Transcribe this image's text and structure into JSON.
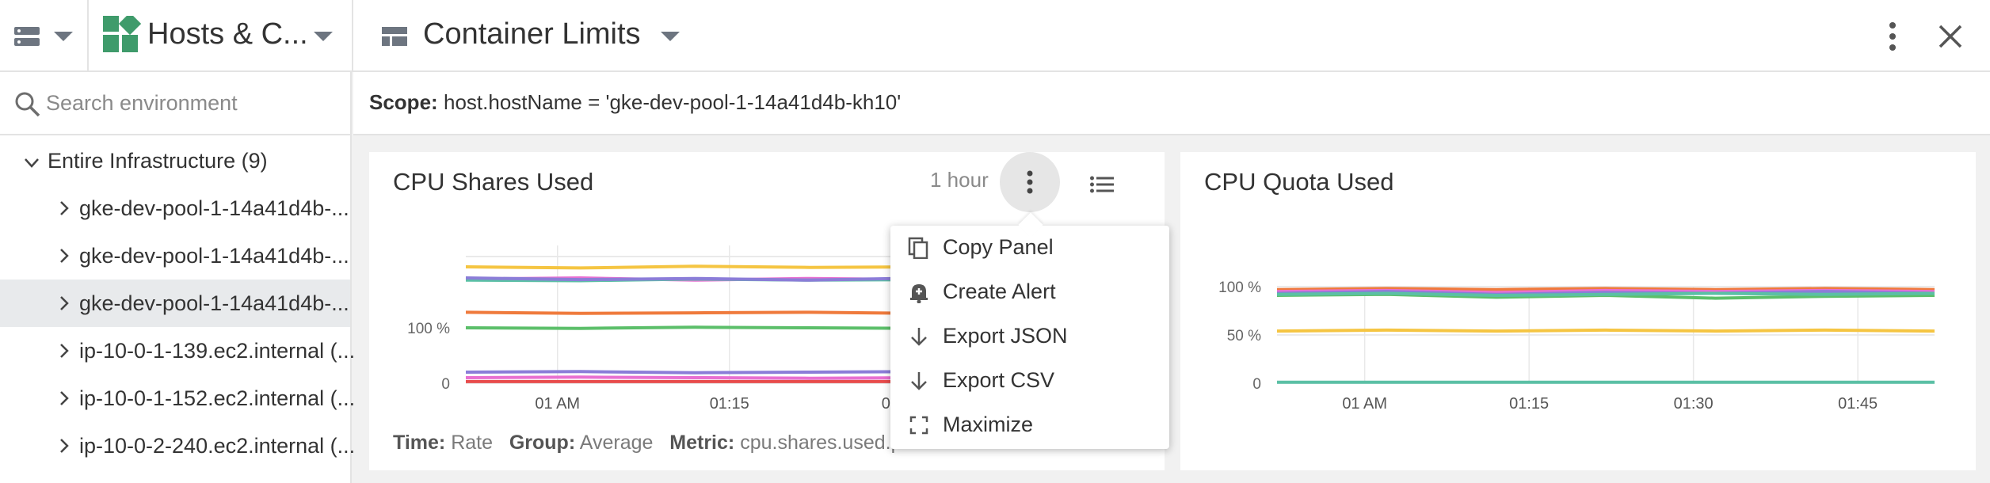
{
  "header": {
    "breadcrumb_title": "Hosts & C...",
    "dashboard_title": "Container Limits"
  },
  "sidebar": {
    "search_placeholder": "Search environment",
    "root_label": "Entire Infrastructure (9)",
    "items": [
      {
        "label": "gke-dev-pool-1-14a41d4b-...",
        "selected": false
      },
      {
        "label": "gke-dev-pool-1-14a41d4b-...",
        "selected": false
      },
      {
        "label": "gke-dev-pool-1-14a41d4b-...",
        "selected": true
      },
      {
        "label": "ip-10-0-1-139.ec2.internal (...",
        "selected": false
      },
      {
        "label": "ip-10-0-1-152.ec2.internal (...",
        "selected": false
      },
      {
        "label": "ip-10-0-2-240.ec2.internal (...",
        "selected": false
      }
    ]
  },
  "scope": {
    "label": "Scope:",
    "value": "host.hostName = 'gke-dev-pool-1-14a41d4b-kh10'"
  },
  "panels": [
    {
      "title": "CPU Shares Used",
      "time_range": "1 hour",
      "footer": {
        "time_label": "Time:",
        "time_value": "Rate",
        "group_label": "Group:",
        "group_value": "Average",
        "metric_label": "Metric:",
        "metric_value": "cpu.shares.used.pe"
      }
    },
    {
      "title": "CPU Quota Used"
    }
  ],
  "menu": {
    "items": [
      {
        "label": "Copy Panel",
        "icon": "copy-icon"
      },
      {
        "label": "Create Alert",
        "icon": "alert-bell-icon"
      },
      {
        "label": "Export JSON",
        "icon": "download-arrow-icon"
      },
      {
        "label": "Export CSV",
        "icon": "download-arrow-icon"
      },
      {
        "label": "Maximize",
        "icon": "maximize-icon"
      }
    ]
  },
  "chart_data": [
    {
      "type": "line",
      "title": "CPU Shares Used",
      "y_ticks": [
        "0",
        "100 %"
      ],
      "x_ticks": [
        "01 AM",
        "01:15",
        "01:30",
        "01:45"
      ],
      "ylim": [
        0,
        220
      ],
      "x_minutes": [
        0,
        10,
        20,
        30,
        40,
        50,
        60
      ],
      "grid": true,
      "series": [
        {
          "color": "#f5c542",
          "values": [
            210,
            208,
            211,
            209,
            210,
            207,
            209
          ]
        },
        {
          "color": "#e86fd1",
          "values": [
            188,
            190,
            186,
            189,
            187,
            190,
            188
          ]
        },
        {
          "color": "#5bc0a5",
          "values": [
            186,
            185,
            188,
            186,
            187,
            185,
            186
          ]
        },
        {
          "color": "#8b7dd8",
          "values": [
            190,
            187,
            189,
            186,
            190,
            188,
            189
          ]
        },
        {
          "color": "#ef7a3c",
          "values": [
            128,
            126,
            127,
            128,
            126,
            127,
            128
          ]
        },
        {
          "color": "#5cbf6a",
          "values": [
            100,
            99,
            101,
            100,
            99,
            100,
            101
          ]
        },
        {
          "color": "#8b7dd8",
          "values": [
            20,
            21,
            19,
            20,
            21,
            20,
            20
          ]
        },
        {
          "color": "#e86fd1",
          "values": [
            10,
            11,
            10,
            9,
            10,
            11,
            10
          ]
        },
        {
          "color": "#e84c4c",
          "values": [
            3,
            3,
            3,
            3,
            3,
            3,
            3
          ]
        }
      ]
    },
    {
      "type": "line",
      "title": "CPU Quota Used",
      "y_ticks": [
        "0",
        "50 %",
        "100 %"
      ],
      "x_ticks": [
        "01 AM",
        "01:15",
        "01:30",
        "01:45"
      ],
      "ylim": [
        0,
        100
      ],
      "x_minutes": [
        0,
        10,
        20,
        30,
        40,
        50,
        60
      ],
      "grid": true,
      "series": [
        {
          "color": "#ef7a3c",
          "values": [
            97,
            98,
            97,
            98,
            97,
            98,
            97
          ]
        },
        {
          "color": "#e86fd1",
          "values": [
            95,
            96,
            94,
            96,
            95,
            96,
            95
          ]
        },
        {
          "color": "#8b7dd8",
          "values": [
            93,
            95,
            92,
            94,
            93,
            95,
            93
          ]
        },
        {
          "color": "#5cbf6a",
          "values": [
            91,
            92,
            89,
            91,
            88,
            90,
            91
          ]
        },
        {
          "color": "#5bc0a5",
          "values": [
            92,
            93,
            91,
            92,
            93,
            92,
            93
          ]
        },
        {
          "color": "#f5c542",
          "values": [
            54,
            55,
            54,
            55,
            54,
            55,
            54
          ]
        },
        {
          "color": "#5bc0a5",
          "values": [
            1,
            1,
            1,
            1,
            1,
            1,
            1
          ]
        }
      ]
    }
  ]
}
